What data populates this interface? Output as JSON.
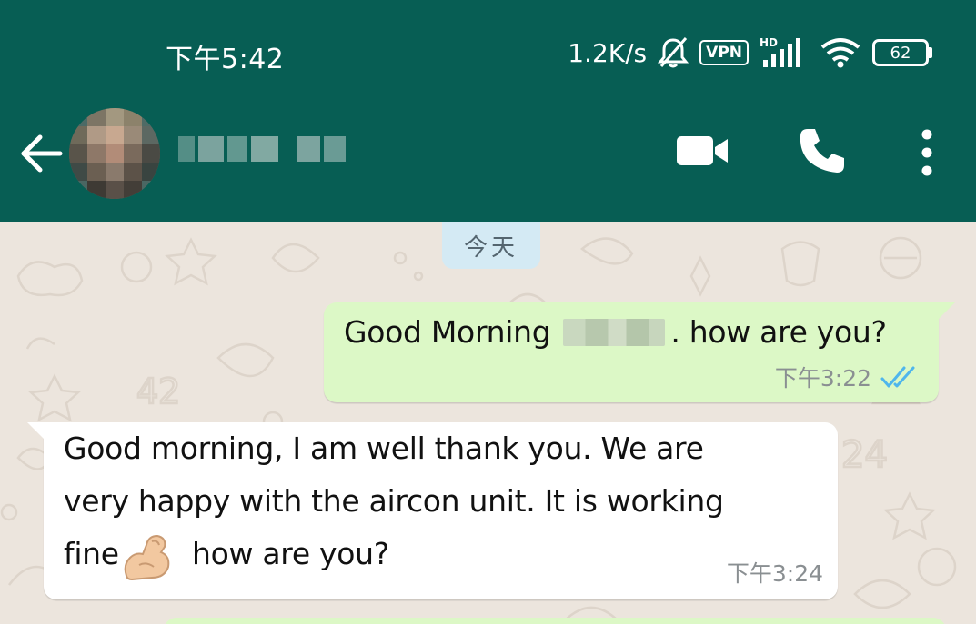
{
  "status_bar": {
    "time": "下午5:42",
    "net_speed": "1.2K/s",
    "vpn_label": "VPN",
    "hd_label": "HD",
    "battery_level": "62",
    "icons": [
      "mute-bell-icon",
      "signal-icon",
      "wifi-icon",
      "battery-icon"
    ]
  },
  "header": {
    "back_icon": "arrow-left-icon",
    "video_icon": "video-camera-icon",
    "call_icon": "phone-icon",
    "menu_icon": "more-vertical-icon"
  },
  "chat": {
    "date_chip": "今天",
    "messages": [
      {
        "direction": "outgoing",
        "text_before": "Good Morning",
        "text_after": ". how are you?",
        "time": "下午3:22",
        "status": "read"
      },
      {
        "direction": "incoming",
        "lines": [
          "Good morning, I am well thank you. We are",
          "very happy with the aircon unit. It is working"
        ],
        "line3_before": "fine",
        "line3_after": " how are you?",
        "emoji": "flexed-biceps-emoji",
        "time": "下午3:24"
      }
    ]
  },
  "colors": {
    "header": "#075E54",
    "wallpaper": "#ECE5DD",
    "outgoing_bubble": "#DCF8C6",
    "incoming_bubble": "#FFFFFF",
    "date_chip": "#D4EAF4",
    "read_ticks": "#4FB6EC"
  }
}
